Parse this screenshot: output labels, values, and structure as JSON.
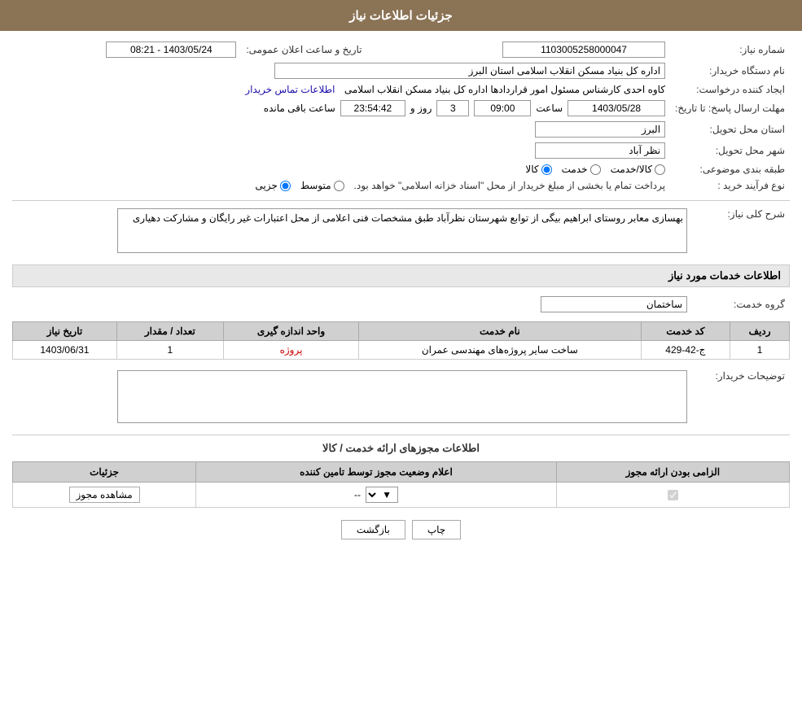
{
  "header": {
    "title": "جزئیات اطلاعات نیاز"
  },
  "labels": {
    "need_number": "شماره نیاز:",
    "buyer_org": "نام دستگاه خریدار:",
    "requester": "ایجاد کننده درخواست:",
    "reply_deadline": "مهلت ارسال پاسخ: تا تاریخ:",
    "delivery_province": "استان محل تحویل:",
    "delivery_city": "شهر محل تحویل:",
    "category": "طبقه بندی موضوعی:",
    "process_type": "نوع فرآیند خرید :",
    "need_description": "شرح کلی نیاز:",
    "service_info": "اطلاعات خدمات مورد نیاز",
    "service_group": "گروه خدمت:",
    "buyer_desc": "توضیحات خریدار:",
    "permits_info": "اطلاعات مجوزهای ارائه خدمت / کالا",
    "announcement_datetime": "تاریخ و ساعت اعلان عمومی:"
  },
  "values": {
    "need_number": "1103005258000047",
    "buyer_org": "اداره کل بنیاد مسکن انقلاب اسلامی استان البرز",
    "requester": "کاوه احدی کارشناس مسئول امور قراردادها اداره کل بنیاد مسکن انقلاب اسلامی",
    "contact_link": "اطلاعات تماس خریدار",
    "reply_date": "1403/05/28",
    "reply_time": "09:00",
    "time_remaining_days": "3",
    "time_remaining_time": "23:54:42",
    "time_remaining_label": "روز و",
    "time_remaining_suffix": "ساعت باقی مانده",
    "delivery_province": "البرز",
    "delivery_city": "نظر آباد",
    "announcement_datetime": "1403/05/24 - 08:21",
    "service_group_value": "ساختمان",
    "need_desc_text": "بهسازی معابر روستای ابراهیم بیگی از توابع شهرستان نظرآباد طبق مشخصات فنی اعلامی از محل اعتبارات غیر رایگان و مشارکت دهیاری",
    "process_type_text": "پرداخت تمام یا بخشی از مبلغ خریدار از محل \"اسناد خزانه اسلامی\" خواهد بود.",
    "process_type_label_1": "جزیی",
    "process_type_label_2": "متوسط",
    "category_label_1": "کالا",
    "category_label_2": "خدمت",
    "category_label_3": "کالا/خدمت"
  },
  "services_table": {
    "columns": [
      "ردیف",
      "کد خدمت",
      "نام خدمت",
      "واحد اندازه گیری",
      "تعداد / مقدار",
      "تاریخ نیاز"
    ],
    "rows": [
      {
        "row": "1",
        "code": "ج-42-429",
        "name": "ساخت سایر پروژه‌های مهندسی عمران",
        "unit": "پروژه",
        "quantity": "1",
        "date": "1403/06/31",
        "unit_link": true
      }
    ]
  },
  "permits_table": {
    "columns": [
      "الزامی بودن ارائه مجوز",
      "اعلام وضعیت مجوز توسط تامین کننده",
      "جزئیات"
    ],
    "rows": [
      {
        "required": "checked",
        "status": "--",
        "details_label": "مشاهده مجوز"
      }
    ]
  },
  "buttons": {
    "print": "چاپ",
    "back": "بازگشت"
  }
}
